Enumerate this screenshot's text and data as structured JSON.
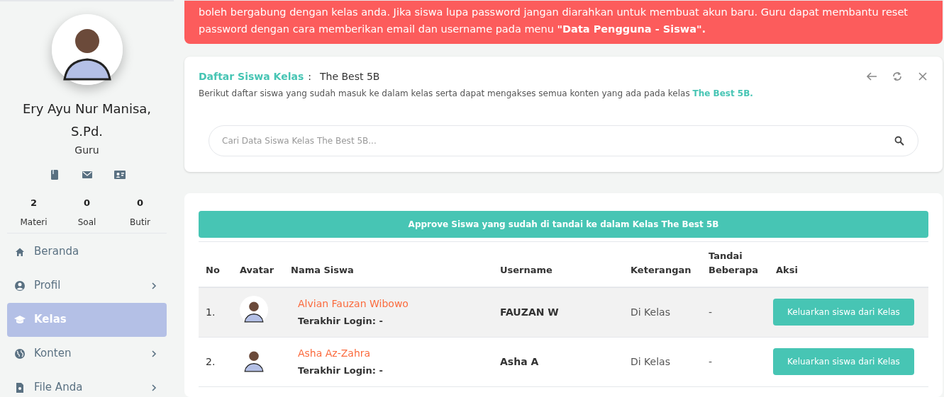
{
  "sidebar": {
    "profile": {
      "name": "Ery Ayu Nur Manisa, S.Pd.",
      "role": "Guru"
    },
    "quick_icons": [
      {
        "kind": "book"
      },
      {
        "kind": "mail"
      },
      {
        "kind": "contact"
      }
    ],
    "stats": [
      {
        "value": "2",
        "label": "Materi"
      },
      {
        "value": "0",
        "label": "Soal"
      },
      {
        "value": "0",
        "label": "Butir"
      }
    ],
    "items": [
      {
        "label": "Beranda",
        "kind": "home",
        "has_submenu": false,
        "selected": false
      },
      {
        "label": "Profil",
        "kind": "user",
        "has_submenu": true,
        "selected": false
      },
      {
        "label": "Kelas",
        "kind": "school",
        "has_submenu": false,
        "selected": true
      },
      {
        "label": "Konten",
        "kind": "globe",
        "has_submenu": true,
        "selected": false
      },
      {
        "label": "File Anda",
        "kind": "file",
        "has_submenu": true,
        "selected": false
      }
    ]
  },
  "alert": {
    "text": "boleh bergabung dengan kelas anda. Jika siswa lupa password jangan diarahkan untuk membuat akun baru. Guru dapat membantu reset password dengan cara memberikan email dan username pada menu **\"Data Pengguna - Siswa\".**"
  },
  "class_card": {
    "title": "Daftar Siswa Kelas",
    "separator": ":",
    "class_name": "The Best 5B",
    "description": "Berikut daftar siswa yang sudah masuk ke dalam kelas serta dapat mengakses semua konten yang ada pada kelas",
    "description_class": "The Best 5B.",
    "search": {
      "placeholder": "Cari Data Siswa Kelas The Best 5B..."
    }
  },
  "table": {
    "approve_button": "Approve Siswa yang sudah di tandai ke dalam Kelas The Best 5B",
    "columns": [
      "No",
      "Avatar",
      "Nama Siswa",
      "Username",
      "Keterangan",
      "Tandai Beberapa",
      "Aksi"
    ],
    "rows": [
      {
        "no": "1.",
        "name": "Alvian Fauzan Wibowo",
        "last_login": "Terakhir Login: -",
        "username": "FAUZAN W",
        "status": "Di Kelas",
        "mark": "-",
        "action": "Keluarkan siswa dari Kelas",
        "highlighted": true
      },
      {
        "no": "2.",
        "name": "Asha Az-Zahra",
        "last_login": "Terakhir Login: -",
        "username": "Asha A",
        "status": "Di Kelas",
        "mark": "-",
        "action": "Keluarkan siswa dari Kelas",
        "highlighted": false
      }
    ]
  }
}
